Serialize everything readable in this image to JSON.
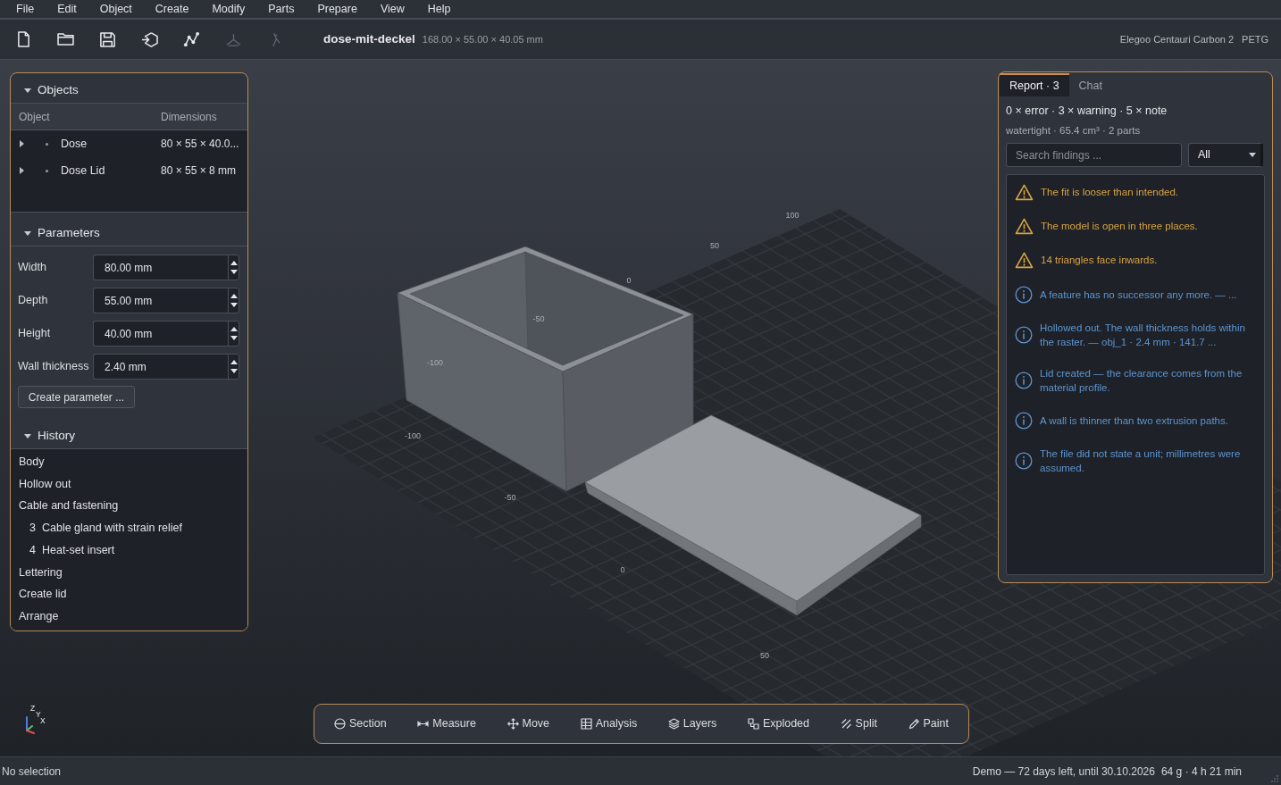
{
  "menu": [
    "File",
    "Edit",
    "Object",
    "Create",
    "Modify",
    "Parts",
    "Prepare",
    "View",
    "Help"
  ],
  "toolbar": {
    "buttons": [
      {
        "disabled": false
      },
      {
        "disabled": false
      },
      {
        "disabled": false
      },
      {
        "disabled": false
      },
      {
        "disabled": false
      },
      {
        "disabled": true
      },
      {
        "disabled": true
      }
    ],
    "file_name": "dose-mit-deckel",
    "dimensions": "168.00 × 55.00 × 40.05 mm",
    "printer": "Elegoo Centauri Carbon 2",
    "material": "PETG"
  },
  "objects": {
    "title": "Objects",
    "expanded": true,
    "columns": [
      "Object",
      "Dimensions"
    ],
    "rows": [
      {
        "name": "Dose",
        "dimensions": "80 × 55 × 40.0...",
        "expanded": false
      },
      {
        "name": "Dose Lid",
        "dimensions": "80 × 55 × 8 mm",
        "expanded": false
      }
    ]
  },
  "parameters": {
    "title": "Parameters",
    "expanded": true,
    "fields": [
      {
        "label": "Width",
        "value": "80.00 mm"
      },
      {
        "label": "Depth",
        "value": "55.00 mm"
      },
      {
        "label": "Height",
        "value": "40.00 mm"
      },
      {
        "label": "Wall thickness",
        "value": "2.40 mm"
      }
    ],
    "create_button": "Create parameter ..."
  },
  "history": {
    "title": "History",
    "expanded": true,
    "items": [
      {
        "label": "Body"
      },
      {
        "label": "Hollow out"
      },
      {
        "label": "Cable and fastening",
        "children": [
          {
            "number": "3",
            "label": "Cable gland with strain relief"
          },
          {
            "number": "4",
            "label": "Heat-set insert"
          }
        ]
      },
      {
        "label": "Lettering"
      },
      {
        "label": "Create lid"
      },
      {
        "label": "Arrange"
      }
    ]
  },
  "viewport": {
    "axis_a_labels": [
      "100",
      "50",
      "0",
      "-50",
      "-100"
    ],
    "axis_b_labels": [
      "-100",
      "-50",
      "0",
      "50"
    ],
    "gizmo_axes": [
      "Z",
      "Y",
      "X"
    ]
  },
  "tools": [
    "Section",
    "Measure",
    "Move",
    "Analysis",
    "Layers",
    "Exploded",
    "Split",
    "Paint"
  ],
  "report": {
    "tabs": [
      {
        "label": "Report · 3",
        "selected": true
      },
      {
        "label": "Chat",
        "selected": false
      }
    ],
    "summary": "0 × error · 3 × warning · 5 × note",
    "model_summary": "watertight · 65.4 cm³ · 2 parts",
    "search": {
      "placeholder": "Search findings ..."
    },
    "filter": "All",
    "findings": [
      {
        "kind": "warning",
        "text": "The fit is looser than intended."
      },
      {
        "kind": "warning",
        "text": "The model is open in three places."
      },
      {
        "kind": "warning",
        "text": "14 triangles face inwards."
      },
      {
        "kind": "note",
        "text": "A feature has no successor any more. — ..."
      },
      {
        "kind": "note",
        "text": "Hollowed out. The wall thickness holds within the raster. — obj_1 · 2.4 mm · 141.7 ..."
      },
      {
        "kind": "note",
        "text": "Lid created — the clearance comes from the material profile."
      },
      {
        "kind": "note",
        "text": "A wall is thinner than two extrusion paths."
      },
      {
        "kind": "note",
        "text": "The file did not state a unit; millimetres were assumed."
      }
    ]
  },
  "status_bar": {
    "left": "No selection",
    "license": "Demo — 72 days left, until 30.10.2026",
    "estimate": "64 g · 4 h 21 min"
  }
}
